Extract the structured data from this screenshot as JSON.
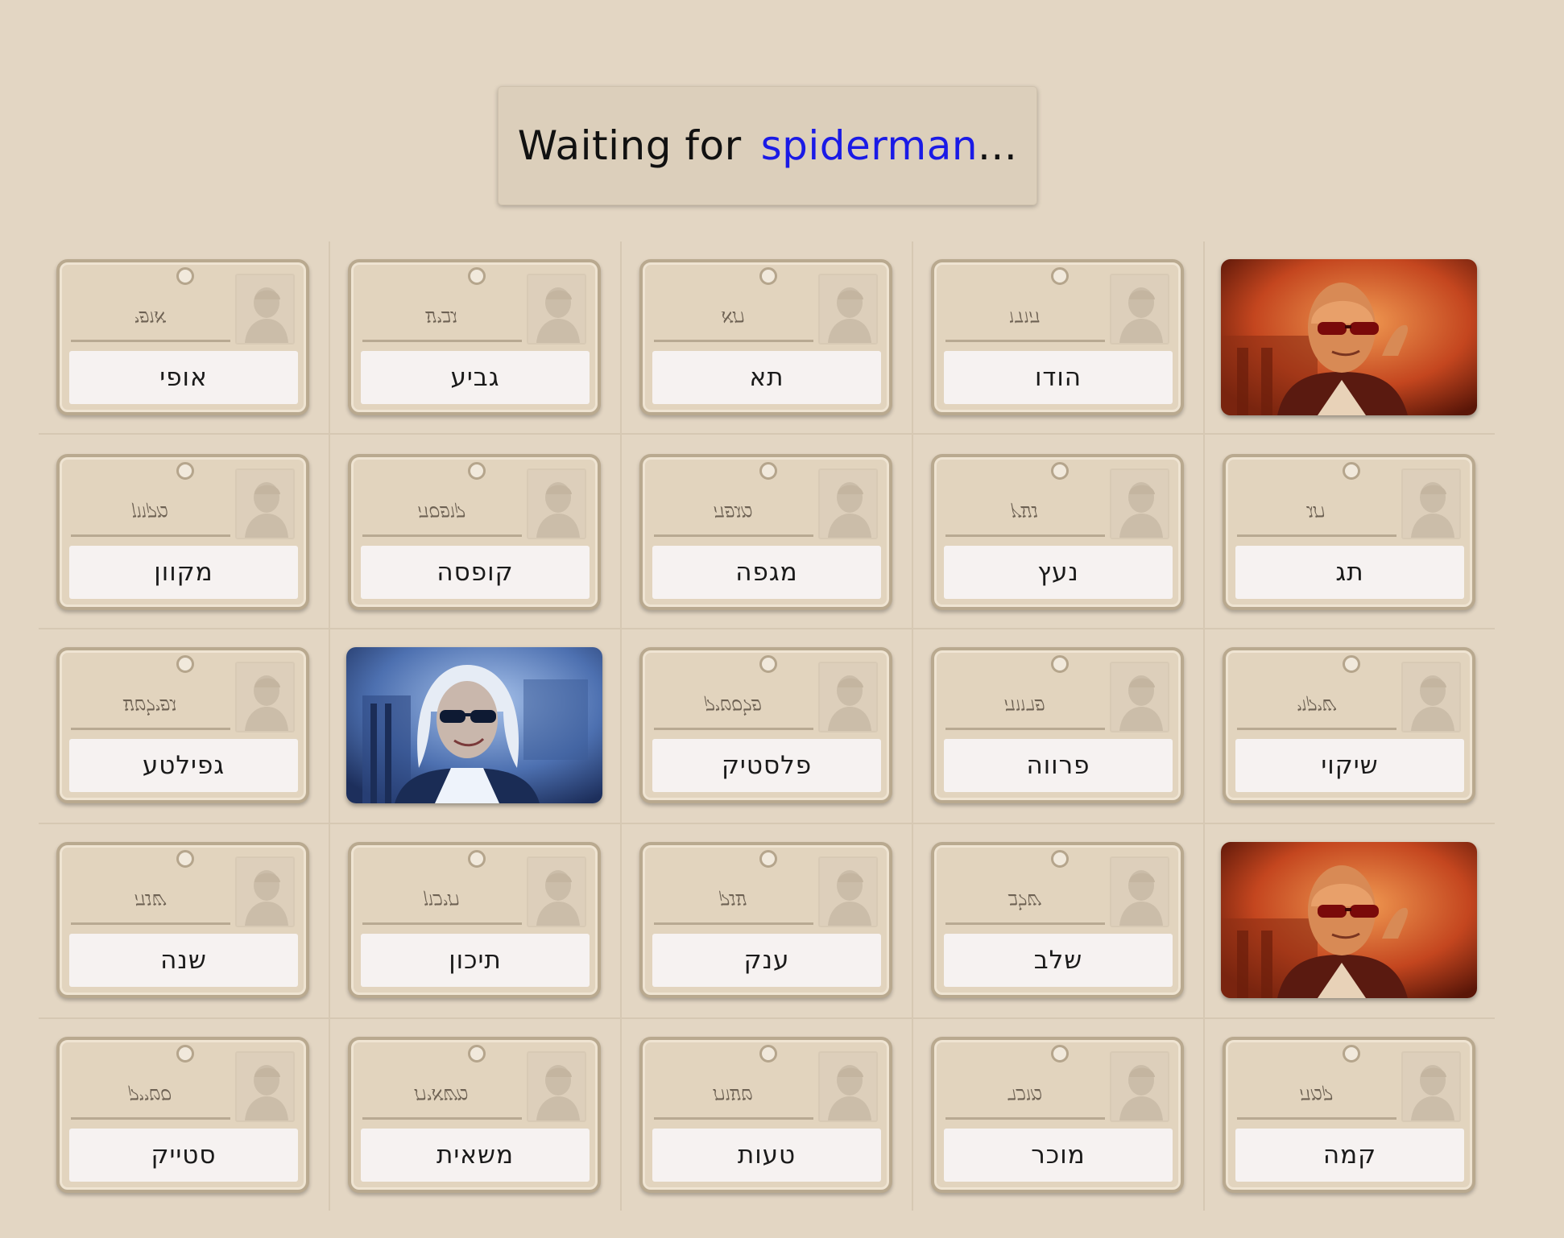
{
  "status": {
    "prefix": "Waiting for",
    "player": "spiderman",
    "suffix": "..."
  },
  "colors": {
    "background": "#e3d6c3",
    "player_name": "#1a1ae6",
    "red_agent": "#c8542a",
    "blue_agent": "#3a5f9e"
  },
  "board": {
    "rows": [
      [
        {
          "type": "word",
          "word": "אופי"
        },
        {
          "type": "word",
          "word": "גביע"
        },
        {
          "type": "word",
          "word": "תא"
        },
        {
          "type": "word",
          "word": "הודו"
        },
        {
          "type": "agent",
          "team": "red",
          "icon": "red-agent-icon"
        }
      ],
      [
        {
          "type": "word",
          "word": "מקוון"
        },
        {
          "type": "word",
          "word": "קופסה"
        },
        {
          "type": "word",
          "word": "מגפה"
        },
        {
          "type": "word",
          "word": "נעץ"
        },
        {
          "type": "word",
          "word": "תג"
        }
      ],
      [
        {
          "type": "word",
          "word": "גפילטע"
        },
        {
          "type": "agent",
          "team": "blue",
          "icon": "blue-agent-icon"
        },
        {
          "type": "word",
          "word": "פלסטיק"
        },
        {
          "type": "word",
          "word": "פרווה"
        },
        {
          "type": "word",
          "word": "שיקוי"
        }
      ],
      [
        {
          "type": "word",
          "word": "שנה"
        },
        {
          "type": "word",
          "word": "תיכון"
        },
        {
          "type": "word",
          "word": "ענק"
        },
        {
          "type": "word",
          "word": "שלב"
        },
        {
          "type": "agent",
          "team": "red",
          "icon": "red-agent-icon"
        }
      ],
      [
        {
          "type": "word",
          "word": "סטייק"
        },
        {
          "type": "word",
          "word": "משאית"
        },
        {
          "type": "word",
          "word": "טעות"
        },
        {
          "type": "word",
          "word": "מוכר"
        },
        {
          "type": "word",
          "word": "קמה"
        }
      ]
    ]
  }
}
